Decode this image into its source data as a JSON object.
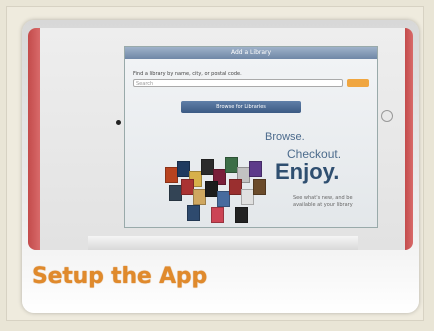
{
  "slide": {
    "title": "Setup the App"
  },
  "screen": {
    "header": "Add a Library",
    "find_label": "Find a library by name, city, or postal code.",
    "search_placeholder": "Search",
    "browse_button": "Browse for Libraries",
    "tagline": [
      "Browse.",
      "Checkout.",
      "Enjoy."
    ],
    "small_note": "See what's new, and be available at your library"
  },
  "colors": {
    "title": "#e08a2c",
    "background": "#e9e5d6",
    "accent_red": "#c34b4b"
  }
}
